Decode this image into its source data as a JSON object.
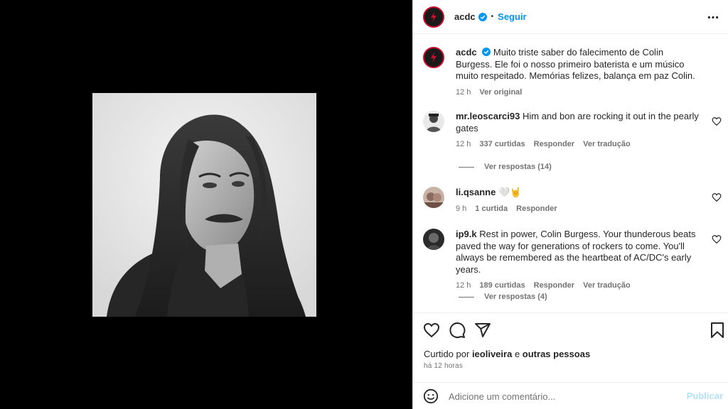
{
  "post": {
    "author": "acdc",
    "follow_label": "Seguir",
    "dot": "•",
    "caption": "Muito triste saber do falecimento de Colin Burgess. Ele foi o nosso primeiro baterista e um músico muito respeitado. Memórias felizes, balança em paz Colin.",
    "caption_time": "12 h",
    "see_original": "Ver original"
  },
  "comments": [
    {
      "user": "mr.leoscarci93",
      "text": "Him and bon are rocking it out in the pearly gates",
      "time": "12 h",
      "likes": "337 curtidas",
      "reply": "Responder",
      "translate": "Ver tradução",
      "replies": "Ver respostas (14)"
    },
    {
      "user": "li.qsanne",
      "text": "🤍🤘",
      "time": "9 h",
      "likes": "1 curtida",
      "reply": "Responder"
    },
    {
      "user": "ip9.k",
      "text": "Rest in power, Colin Burgess. Your thunderous beats paved the way for generations of rockers to come. You'll always be remembered as the heartbeat of AC/DC's early years.",
      "time": "12 h",
      "likes": "189 curtidas",
      "reply": "Responder",
      "translate": "Ver tradução",
      "replies": "Ver respostas (4)"
    }
  ],
  "liked_by": {
    "prefix": "Curtido por",
    "user": "ieoliveira",
    "joiner": "e",
    "others": "outras pessoas"
  },
  "post_time": "há 12 horas",
  "composer": {
    "placeholder": "Adicione um comentário...",
    "publish_label": "Publicar"
  },
  "icons": {
    "like": "heart-icon",
    "comment": "comment-icon",
    "share": "share-icon",
    "save": "bookmark-icon",
    "more": "more-horizontal-icon",
    "emoji": "emoji-icon",
    "verified": "verified-badge-icon"
  },
  "colors": {
    "link": "#0095f6",
    "publish_disabled": "#b2dffc",
    "brand_red": "#c8102e"
  }
}
